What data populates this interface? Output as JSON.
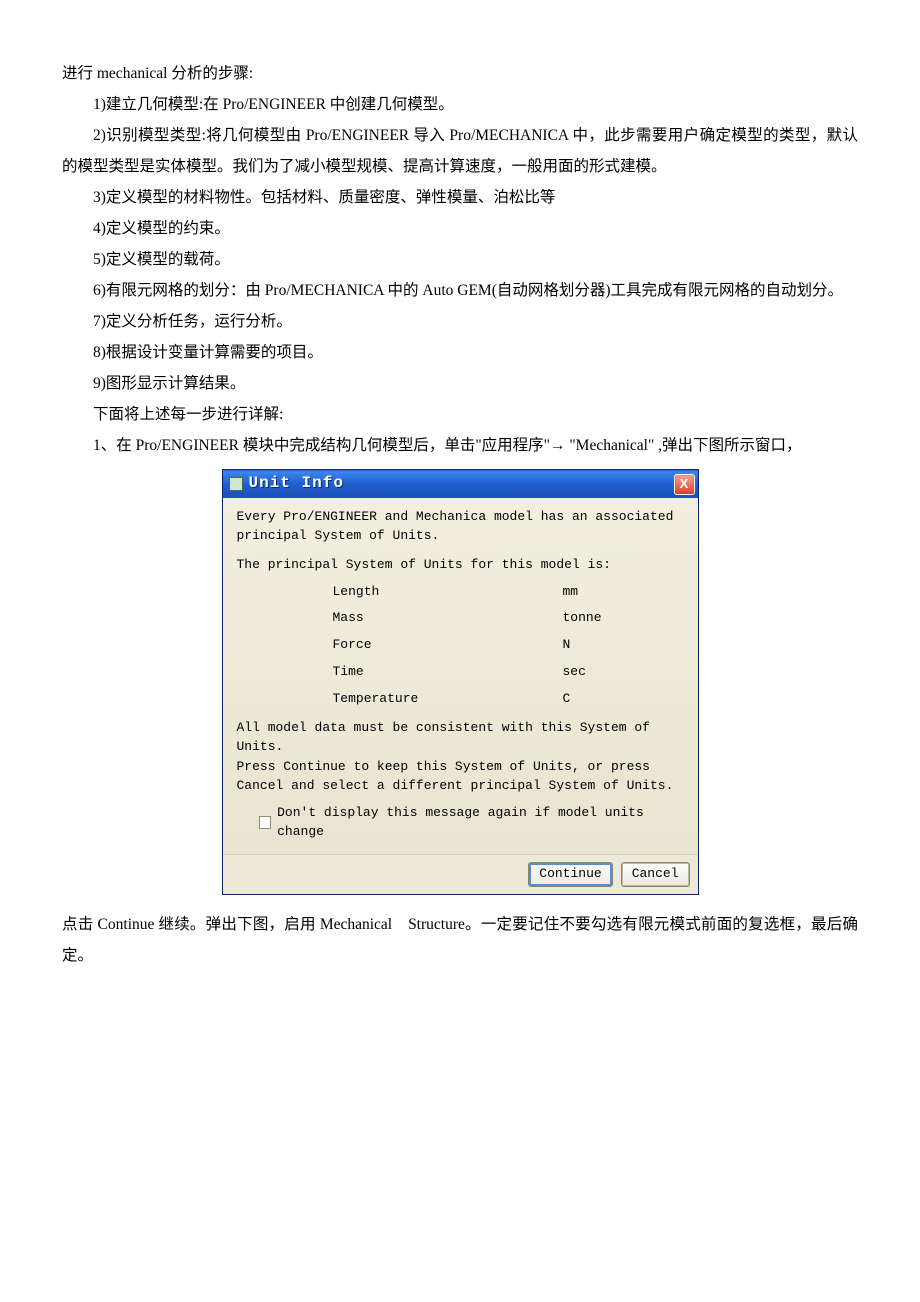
{
  "doc": {
    "intro": "进行 mechanical 分析的步骤:",
    "items": [
      "1)建立几何模型:在 Pro/ENGINEER 中创建几何模型。",
      "2)识别模型类型:将几何模型由 Pro/ENGINEER 导入 Pro/MECHANICA 中，此步需要用户确定模型的类型，默认的模型类型是实体模型。我们为了减小模型规模、提高计算速度，一般用面的形式建模。",
      "3)定义模型的材料物性。包括材料、质量密度、弹性模量、泊松比等",
      "4)定义模型的约束。",
      "5)定义模型的载荷。",
      "6)有限元网格的划分：由 Pro/MECHANICA 中的 Auto GEM(自动网格划分器)工具完成有限元网格的自动划分。",
      "7)定义分析任务，运行分析。",
      "8)根据设计变量计算需要的项目。",
      "9)图形显示计算结果。"
    ],
    "detail_intro": "下面将上述每一步进行详解:",
    "step1": "1、在 Pro/ENGINEER 模块中完成结构几何模型后，单击\"应用程序\"→ \"Mechanical\" ,弹出下图所示窗口，",
    "after_dialog": "点击 Continue 继续。弹出下图，启用 Mechanical　Structure。一定要记住不要勾选有限元模式前面的复选框，最后确定。"
  },
  "dialog": {
    "title": "Unit Info",
    "line1": "Every Pro/ENGINEER and Mechanica model has an associated principal System of Units.",
    "line2": "The principal System of Units for this model is:",
    "units": [
      {
        "label": "Length",
        "value": "mm"
      },
      {
        "label": "Mass",
        "value": "tonne"
      },
      {
        "label": "Force",
        "value": "N"
      },
      {
        "label": "Time",
        "value": "sec"
      },
      {
        "label": "Temperature",
        "value": "C"
      }
    ],
    "note1": "All model data must be consistent with this System of Units.",
    "note2": "Press Continue to keep this System of Units, or press Cancel and select a different principal System of Units.",
    "checkbox_label": "Don't display this message again if model units change",
    "btn_continue": "Continue",
    "btn_cancel": "Cancel",
    "close_glyph": "X"
  }
}
